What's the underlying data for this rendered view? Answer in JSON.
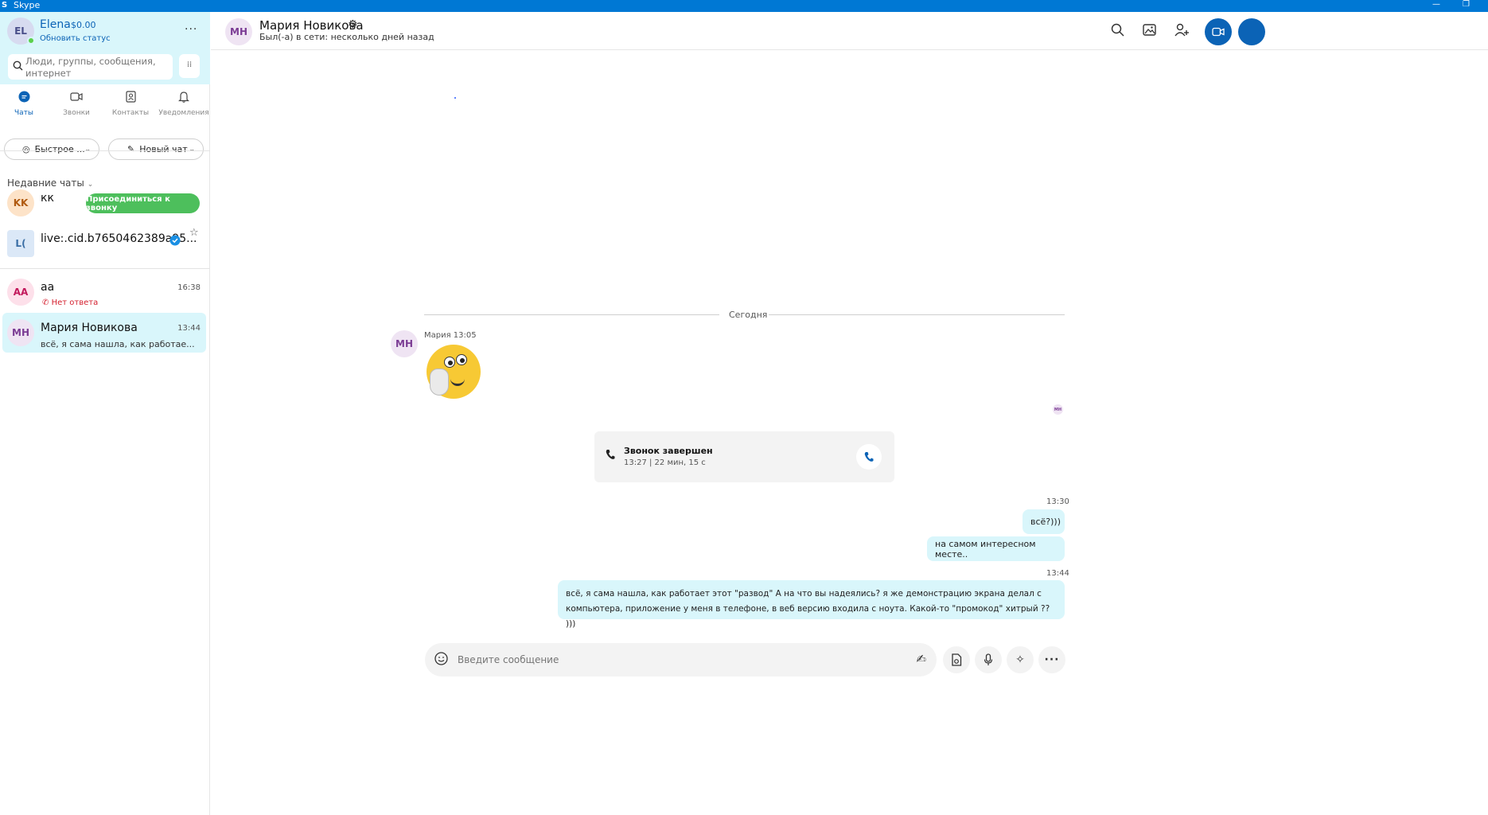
{
  "window": {
    "title": "Skype",
    "controls": [
      "—",
      "❐"
    ]
  },
  "colors": {
    "accent": "#0b63b6",
    "sidebar_bg": "#d9f6fb",
    "join_green": "#4dbf5c",
    "missed_red": "#d41f2e"
  },
  "profile": {
    "initials": "EL",
    "name": "Elena",
    "balance": "$0.00",
    "status_link": "Обновить статус",
    "more": "···"
  },
  "search": {
    "placeholder": "Люди, группы, сообщения, интернет",
    "icon": "search-icon",
    "dialpad_icon": "dialpad-icon"
  },
  "nav": {
    "tabs": [
      {
        "label": "Чаты",
        "icon": "chat-icon",
        "active": true
      },
      {
        "label": "Звонки",
        "icon": "video-camera-icon"
      },
      {
        "label": "Контакты",
        "icon": "contacts-icon"
      },
      {
        "label": "Уведомления",
        "icon": "bell-icon"
      }
    ]
  },
  "actions": {
    "quick": "Быстрое ...",
    "new_chat": "Новый чат"
  },
  "recent": {
    "header": "Недавние чаты",
    "items": [
      {
        "initials": "KK",
        "name": "кк",
        "join_label": "Присоединиться к звонку"
      },
      {
        "initials": "L(",
        "name": "live:.cid.b7650462389a95...",
        "verified": true
      },
      {
        "initials": "AA",
        "name": "аа",
        "time": "16:38",
        "sub": "Нет ответа"
      },
      {
        "initials": "MH",
        "name": "Мария Новикова",
        "time": "13:44",
        "sub": "всё, я сама нашла, как работае..."
      }
    ]
  },
  "conversation": {
    "initials": "MH",
    "name": "Мария Новикова",
    "status": "Был(-а) в сети: несколько дней назад",
    "divider": "Сегодня",
    "sender_meta": "Мария 13:05",
    "read_receipt": "MH",
    "call": {
      "title": "Звонок завершен",
      "detail": "13:27 | 22 мин, 15 с"
    },
    "messages": [
      {
        "time": "13:30",
        "text": "всё?)))"
      },
      {
        "text": "на самом интересном месте.."
      },
      {
        "time": "13:44",
        "line1": "всё, я сама нашла, как работает этот \"развод\" А на что вы надеялись?  я же демонстрацию экрана делал с",
        "line2": "компьютера, приложение у меня в телефоне, в веб версию входила с ноута. Какой-то \"промокод\" хитрый ?? )))"
      }
    ]
  },
  "composer": {
    "placeholder": "Введите сообщение"
  }
}
